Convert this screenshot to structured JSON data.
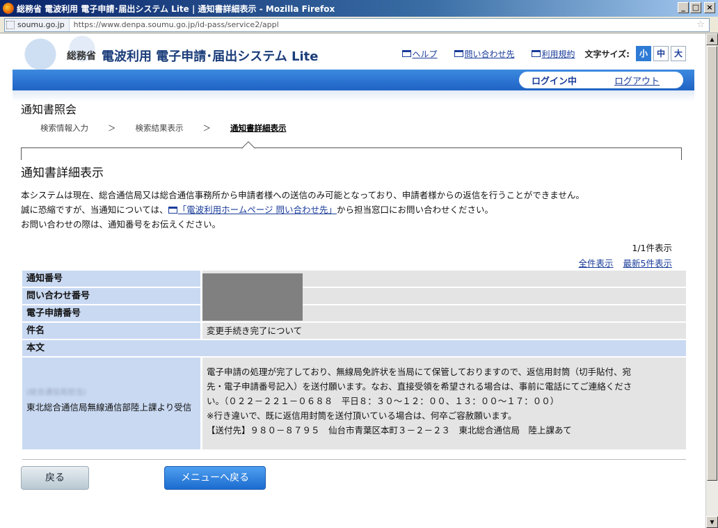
{
  "window": {
    "title": "総務省 電波利用 電子申請･届出システム Lite | 通知書詳細表示 - Mozilla Firefox",
    "buttons": {
      "minimize": "_",
      "maximize": "□",
      "close": "×"
    }
  },
  "urlbar": {
    "site": "soumu.go.jp",
    "url": "https://www.denpa.soumu.go.jp/id-pass/service2/appl"
  },
  "header": {
    "ministry": "総務省",
    "system_name": "電波利用 電子申請･届出システム Lite",
    "links": {
      "help": "ヘルプ",
      "contact": "問い合わせ先",
      "terms": "利用規約"
    },
    "font_size_label": "文字サイズ:",
    "font_sizes": {
      "small": "小",
      "medium": "中",
      "large": "大"
    },
    "login_state": "ログイン中",
    "logout": "ログアウト"
  },
  "section": {
    "title": "通知書照会",
    "breadcrumb": {
      "step1": "検索情報入力",
      "step2": "検索結果表示",
      "step3": "通知書詳細表示",
      "separator": "＞"
    }
  },
  "page": {
    "heading": "通知書詳細表示",
    "notice_line1": "本システムは現在、総合通信局又は総合通信事務所から申請者様への送信のみ可能となっており、申請者様からの返信を行うことができません。",
    "notice_line2_pre": "誠に恐縮ですが、当通知については、",
    "notice_line2_link": "「電波利用ホームページ 問い合わせ先」",
    "notice_line2_post": "から担当窓口にお問い合わせください。",
    "notice_line3": "お問い合わせの際は、通知番号をお伝えください。",
    "count": "1/1件表示",
    "show_all": "全件表示",
    "show_latest5": "最新5件表示"
  },
  "detail": {
    "labels": {
      "notice_no": "通知番号",
      "inquiry_no": "問い合わせ番号",
      "application_no": "電子申請番号",
      "subject": "件名",
      "body": "本文"
    },
    "subject": "変更手続き完了について",
    "sender_blurred": "(総合通信局担当)",
    "sender": "東北総合通信局無線通信部陸上課より受信",
    "body_lines": [
      "電子申請の処理が完了しており、無線局免許状を当局にて保管しておりますので、返信用封筒（切手貼付、宛",
      "先・電子申請番号記入）を送付願います。なお、直接受領を希望される場合は、事前に電話にてご連絡くださ",
      "い。（０２２－２２１－０６８８　平日８：３０～１２：００、１３：００～１７：００）",
      "※行き違いで、既に返信用封筒を送付頂いている場合は、何卒ご容赦願います。",
      "【送付先】９８０－８７９５　仙台市青葉区本町３－２－２３　東北総合通信局　陸上課あて"
    ]
  },
  "buttons": {
    "back": "戻る",
    "to_menu": "メニューへ戻る"
  }
}
